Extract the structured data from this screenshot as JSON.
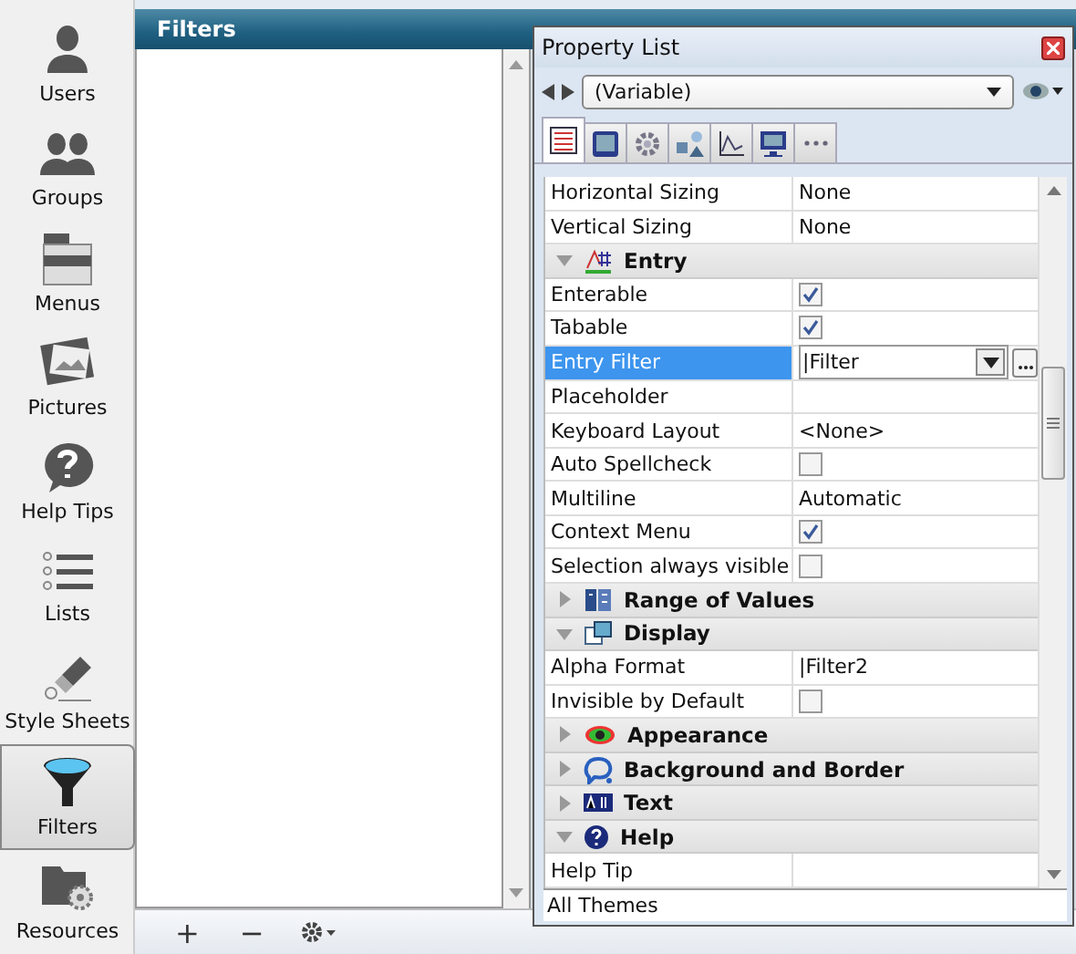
{
  "sidebar": {
    "items": [
      {
        "label": "Users",
        "selected": false
      },
      {
        "label": "Groups",
        "selected": false
      },
      {
        "label": "Menus",
        "selected": false
      },
      {
        "label": "Pictures",
        "selected": false
      },
      {
        "label": "Help Tips",
        "selected": false
      },
      {
        "label": "Lists",
        "selected": false
      },
      {
        "label": "Style Sheets",
        "selected": false
      },
      {
        "label": "Filters",
        "selected": true
      },
      {
        "label": "Resources",
        "selected": false
      }
    ]
  },
  "panel": {
    "title": "Filters",
    "toolbar": [
      "+",
      "−"
    ]
  },
  "property_list": {
    "title": "Property List",
    "object": "(Variable)",
    "tabs": [
      {
        "selected": true
      },
      {
        "selected": false
      },
      {
        "selected": false
      },
      {
        "selected": false
      },
      {
        "selected": false
      },
      {
        "selected": false
      },
      {
        "selected": false
      }
    ],
    "rows": [
      {
        "kind": "value",
        "label": "Horizontal Sizing",
        "value": "None",
        "selected": false
      },
      {
        "kind": "value",
        "label": "Vertical Sizing",
        "value": "None",
        "selected": false
      },
      {
        "kind": "section",
        "label": "Entry",
        "expanded": true
      },
      {
        "kind": "check",
        "label": "Enterable",
        "checked": true,
        "selected": false
      },
      {
        "kind": "check",
        "label": "Tabable",
        "checked": true,
        "selected": false
      },
      {
        "kind": "dropdown",
        "label": "Entry Filter",
        "value": "|Filter",
        "selected": true
      },
      {
        "kind": "value",
        "label": "Placeholder",
        "selected": false
      },
      {
        "kind": "value",
        "label": "Keyboard Layout",
        "value": "<None>",
        "selected": false
      },
      {
        "kind": "check",
        "label": "Auto Spellcheck",
        "checked": false,
        "selected": false
      },
      {
        "kind": "value",
        "label": "Multiline",
        "value": "Automatic",
        "selected": false
      },
      {
        "kind": "check",
        "label": "Context Menu",
        "checked": true,
        "selected": false
      },
      {
        "kind": "check",
        "label": "Selection always visible",
        "checked": false,
        "selected": false
      },
      {
        "kind": "section",
        "label": "Range of Values",
        "expanded": false
      },
      {
        "kind": "section",
        "label": "Display",
        "expanded": true
      },
      {
        "kind": "value",
        "label": "Alpha Format",
        "value": "|Filter2",
        "selected": false
      },
      {
        "kind": "check",
        "label": "Invisible by Default",
        "checked": false,
        "selected": false
      },
      {
        "kind": "section",
        "label": "Appearance",
        "expanded": false
      },
      {
        "kind": "section",
        "label": "Background and Border",
        "expanded": false
      },
      {
        "kind": "section",
        "label": "Text",
        "expanded": false
      },
      {
        "kind": "section",
        "label": "Help",
        "expanded": true
      },
      {
        "kind": "value",
        "label": "Help Tip",
        "selected": false
      }
    ],
    "footer": "All Themes"
  }
}
